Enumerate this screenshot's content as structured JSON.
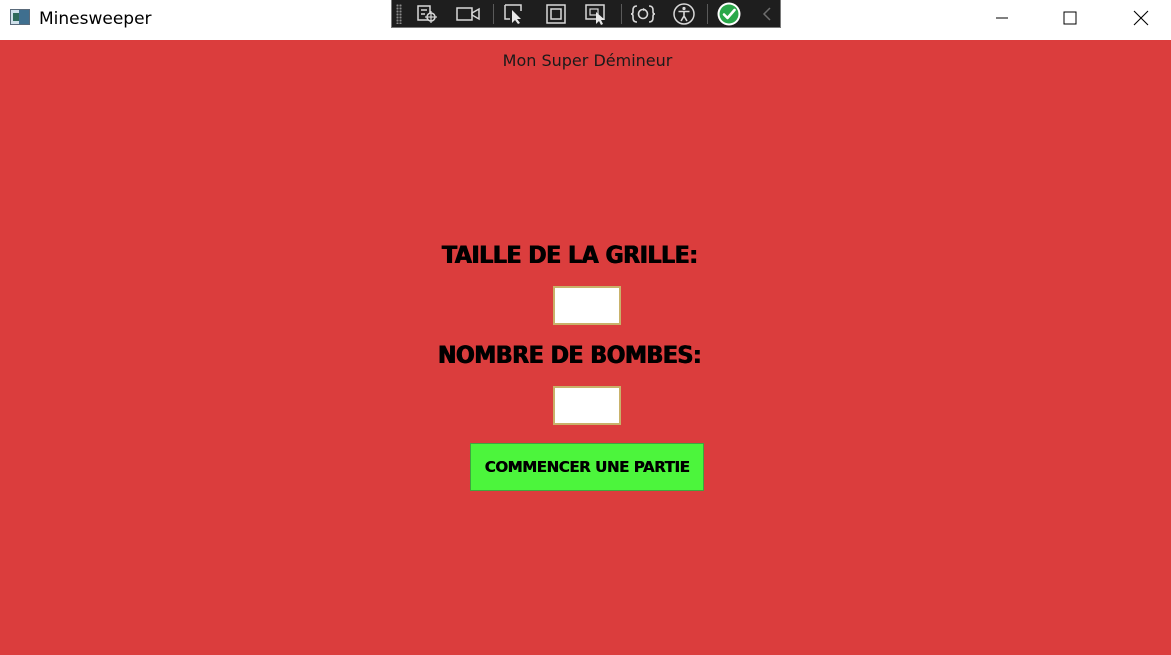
{
  "window": {
    "title": "Minesweeper",
    "icon": "app-window-icon",
    "controls": {
      "minimize_icon": "minimize-icon",
      "maximize_icon": "maximize-icon",
      "close_icon": "close-icon"
    }
  },
  "debug_toolbar": {
    "items": [
      "live-visual-tree-icon",
      "record-video-icon",
      "select-element-icon",
      "display-layout-adorners-icon",
      "track-focused-element-icon",
      "hot-reload-icon",
      "accessibility-icon",
      "checkmark-ok-icon",
      "collapse-chevron-icon"
    ]
  },
  "main": {
    "header": "Mon Super Démineur",
    "grid_size_label": "Taille de la grille:",
    "grid_size_value": "",
    "bomb_count_label": "Nombre de bombes:",
    "bomb_count_value": "",
    "start_button_label": "Commencer une partie"
  },
  "colors": {
    "background": "#db3d3d",
    "button": "#4cf53c",
    "input_border": "#c9b26a"
  }
}
